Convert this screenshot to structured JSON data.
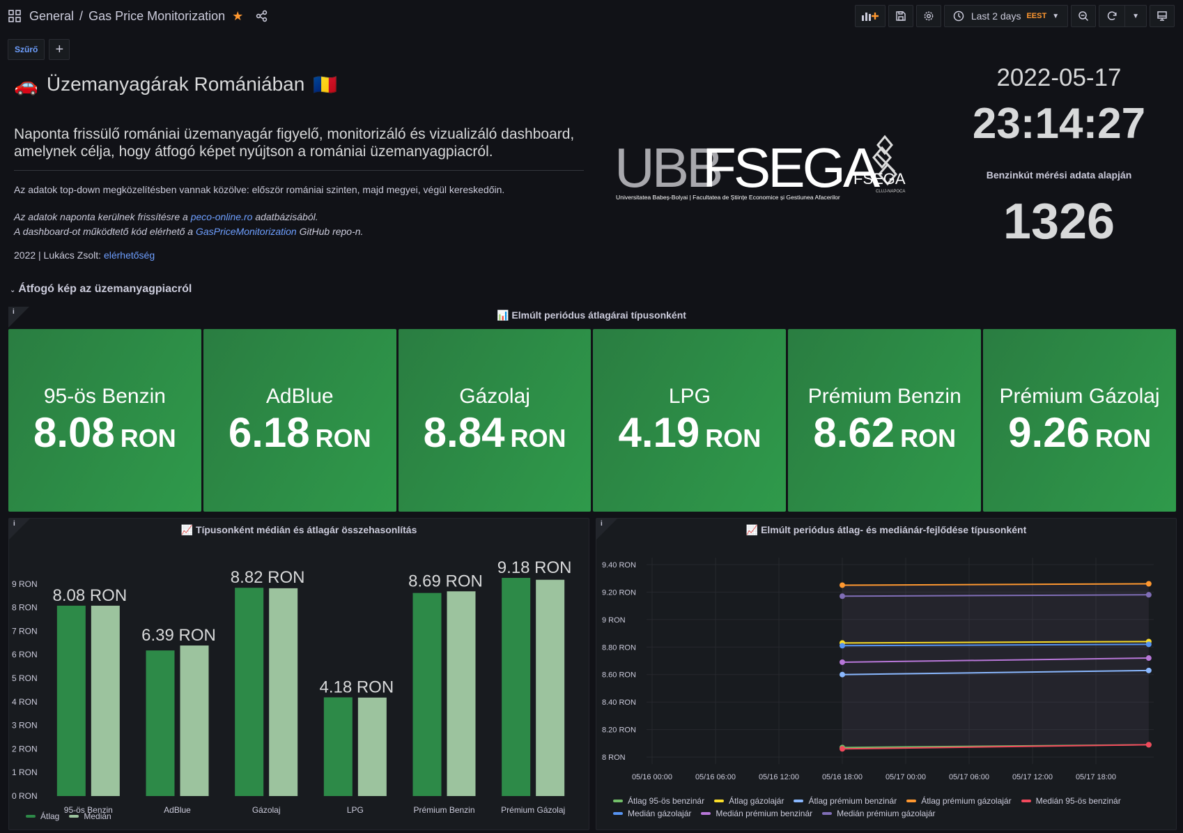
{
  "header": {
    "breadcrumb_folder": "General",
    "breadcrumb_sep": "/",
    "dashboard_title": "Gas Price Monitorization",
    "time_range": "Last 2 days",
    "timezone": "EEST"
  },
  "filterbar": {
    "filter_label": "Szűrő",
    "add_label": "+"
  },
  "intro": {
    "title_emoji": "🚗",
    "title": "Üzemanyagárak Romániában",
    "flag": "🇷🇴",
    "lead": "Naponta frissülő romániai üzemanyagár figyelő, monitorizáló és vizualizáló dashboard, amelynek célja, hogy átfogó képet nyújtson a romániai üzemanyagpiacról.",
    "p1": "Az adatok top-down megközelítésben vannak közölve: először romániai szinten, majd megyei, végül kereskedőin.",
    "p2_pre": "Az adatok naponta kerülnek frissítésre a ",
    "p2_link": "peco-online.ro",
    "p2_post": " adatbázisából.",
    "p3_pre": "A dashboard-ot működtető kód elérhető a ",
    "p3_link": "GasPriceMonitorization",
    "p3_post": " GitHub repo-n.",
    "p4_pre": "2022 | Lukács Zsolt: ",
    "p4_link": "elérhetőség"
  },
  "logo": {
    "main": "UBBFSEGA",
    "sub": "Universitatea Babeș-Bolyai | Facultatea de Științe Economice și Gestiunea Afacerilor",
    "badge": "FSEGA",
    "badge_sub": "CLUJ-NAPOCA"
  },
  "clock": {
    "date": "2022-05-17",
    "time": "23:14:27",
    "caption": "Benzinkút mérési adata alapján",
    "count": "1326"
  },
  "row": {
    "title": "Átfogó kép az üzemanyagpiacról"
  },
  "stats_panel": {
    "title_icon": "📊",
    "title": "Elmúlt periódus átlagárai típusonként",
    "color": "#2f9a4b",
    "items": [
      {
        "name": "95-ös Benzin",
        "value": "8.08",
        "unit": "RON"
      },
      {
        "name": "AdBlue",
        "value": "6.18",
        "unit": "RON"
      },
      {
        "name": "Gázolaj",
        "value": "8.84",
        "unit": "RON"
      },
      {
        "name": "LPG",
        "value": "4.19",
        "unit": "RON"
      },
      {
        "name": "Prémium Benzin",
        "value": "8.62",
        "unit": "RON"
      },
      {
        "name": "Prémium Gázolaj",
        "value": "9.26",
        "unit": "RON"
      }
    ]
  },
  "chart_data": [
    {
      "type": "bar",
      "title_icon": "📈",
      "title": "Típusonként médián és átlagár összehasonlítás",
      "categories": [
        "95-ös Benzin",
        "AdBlue",
        "Gázolaj",
        "LPG",
        "Prémium Benzin",
        "Prémium Gázolaj"
      ],
      "series": [
        {
          "name": "Átlag",
          "color": "#2d8a48",
          "values": [
            8.08,
            6.18,
            8.84,
            4.19,
            8.62,
            9.26
          ]
        },
        {
          "name": "Medián",
          "color": "#9cc39e",
          "values": [
            8.08,
            6.39,
            8.82,
            4.18,
            8.69,
            9.18
          ]
        }
      ],
      "data_labels": [
        "8.08 RON",
        "6.39 RON",
        "8.82 RON",
        "4.18 RON",
        "8.69 RON",
        "9.18 RON"
      ],
      "ylim": [
        0,
        10
      ],
      "yticks": [
        "0 RON",
        "1 RON",
        "2 RON",
        "3 RON",
        "4 RON",
        "5 RON",
        "6 RON",
        "7 RON",
        "8 RON",
        "9 RON"
      ],
      "legend_position": "bottom-left"
    },
    {
      "type": "line",
      "title_icon": "📈",
      "title": "Elmúlt periódus átlag- és mediánár-fejlődése típusonként",
      "x": [
        "05/16 18:00",
        "05/17 23:00"
      ],
      "xticks": [
        "05/16 00:00",
        "05/16 06:00",
        "05/16 12:00",
        "05/16 18:00",
        "05/17 00:00",
        "05/17 06:00",
        "05/17 12:00",
        "05/17 18:00"
      ],
      "yticks": [
        "8 RON",
        "8.20 RON",
        "8.40 RON",
        "8.60 RON",
        "8.80 RON",
        "9 RON",
        "9.20 RON",
        "9.40 RON"
      ],
      "ylim": [
        7.95,
        9.45
      ],
      "series": [
        {
          "name": "Átlag 95-ös benzinár",
          "color": "#73bf69",
          "values": [
            8.07,
            8.09
          ]
        },
        {
          "name": "Átlag gázolajár",
          "color": "#fade2a",
          "values": [
            8.83,
            8.84
          ]
        },
        {
          "name": "Átlag prémium benzinár",
          "color": "#8ab8ff",
          "values": [
            8.6,
            8.63
          ]
        },
        {
          "name": "Átlag prémium gázolajár",
          "color": "#ff9830",
          "values": [
            9.25,
            9.26
          ]
        },
        {
          "name": "Medián 95-ös benzinár",
          "color": "#f2495c",
          "values": [
            8.06,
            8.09
          ]
        },
        {
          "name": "Medián gázolajár",
          "color": "#5794f2",
          "values": [
            8.81,
            8.82
          ]
        },
        {
          "name": "Medián prémium benzinár",
          "color": "#b877d9",
          "values": [
            8.69,
            8.72
          ]
        },
        {
          "name": "Medián prémium gázolajár",
          "color": "#806eb7",
          "values": [
            9.17,
            9.18
          ]
        }
      ],
      "legend_position": "bottom"
    }
  ]
}
